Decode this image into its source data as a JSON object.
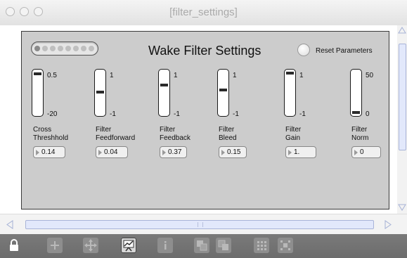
{
  "window": {
    "title": "[filter_settings]"
  },
  "panel": {
    "title": "Wake Filter Settings",
    "reset_label": "Reset Parameters"
  },
  "sliders": [
    {
      "name": "Cross\nThreshhold",
      "max": "0.5",
      "min": "-20",
      "value": "0.14",
      "level": 0.99
    },
    {
      "name": "Filter\nFeedforward",
      "max": "1",
      "min": "-1",
      "value": "0.04",
      "level": 0.52
    },
    {
      "name": "Filter\nFeedback",
      "max": "1",
      "min": "-1",
      "value": "0.37",
      "level": 0.69
    },
    {
      "name": "Filter\nBleed",
      "max": "1",
      "min": "-1",
      "value": "0.15",
      "level": 0.58
    },
    {
      "name": "Filter\nGain",
      "max": "1",
      "min": "-1",
      "value": "1.",
      "level": 1.0
    },
    {
      "name": "Filter\nNorm",
      "max": "50",
      "min": "0",
      "value": "0",
      "level": 0.0
    }
  ],
  "toolbar": {
    "icons": [
      "lock-icon",
      "add-object-icon",
      "move-icon",
      "presentation-icon",
      "info-icon",
      "copy-icon",
      "paste-icon",
      "grid-icon",
      "snap-icon"
    ]
  }
}
